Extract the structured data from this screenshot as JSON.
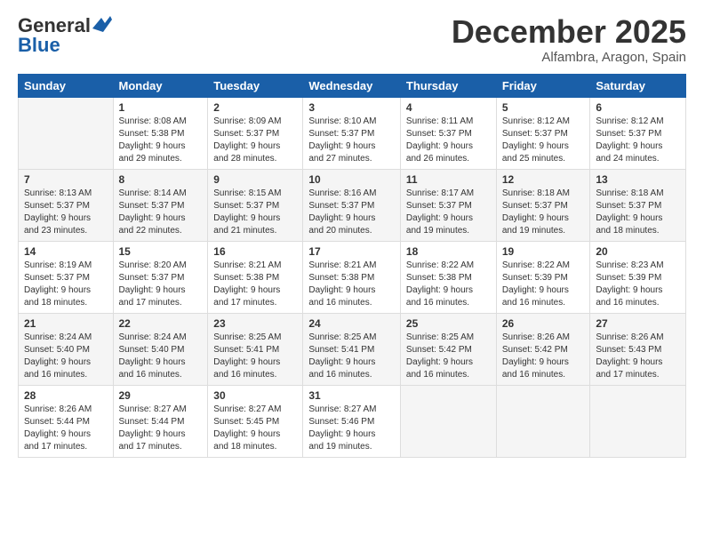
{
  "header": {
    "logo_general": "General",
    "logo_blue": "Blue",
    "month_title": "December 2025",
    "location": "Alfambra, Aragon, Spain"
  },
  "weekdays": [
    "Sunday",
    "Monday",
    "Tuesday",
    "Wednesday",
    "Thursday",
    "Friday",
    "Saturday"
  ],
  "weeks": [
    [
      {
        "day": "",
        "info": ""
      },
      {
        "day": "1",
        "info": "Sunrise: 8:08 AM\nSunset: 5:38 PM\nDaylight: 9 hours\nand 29 minutes."
      },
      {
        "day": "2",
        "info": "Sunrise: 8:09 AM\nSunset: 5:37 PM\nDaylight: 9 hours\nand 28 minutes."
      },
      {
        "day": "3",
        "info": "Sunrise: 8:10 AM\nSunset: 5:37 PM\nDaylight: 9 hours\nand 27 minutes."
      },
      {
        "day": "4",
        "info": "Sunrise: 8:11 AM\nSunset: 5:37 PM\nDaylight: 9 hours\nand 26 minutes."
      },
      {
        "day": "5",
        "info": "Sunrise: 8:12 AM\nSunset: 5:37 PM\nDaylight: 9 hours\nand 25 minutes."
      },
      {
        "day": "6",
        "info": "Sunrise: 8:12 AM\nSunset: 5:37 PM\nDaylight: 9 hours\nand 24 minutes."
      }
    ],
    [
      {
        "day": "7",
        "info": "Sunrise: 8:13 AM\nSunset: 5:37 PM\nDaylight: 9 hours\nand 23 minutes."
      },
      {
        "day": "8",
        "info": "Sunrise: 8:14 AM\nSunset: 5:37 PM\nDaylight: 9 hours\nand 22 minutes."
      },
      {
        "day": "9",
        "info": "Sunrise: 8:15 AM\nSunset: 5:37 PM\nDaylight: 9 hours\nand 21 minutes."
      },
      {
        "day": "10",
        "info": "Sunrise: 8:16 AM\nSunset: 5:37 PM\nDaylight: 9 hours\nand 20 minutes."
      },
      {
        "day": "11",
        "info": "Sunrise: 8:17 AM\nSunset: 5:37 PM\nDaylight: 9 hours\nand 19 minutes."
      },
      {
        "day": "12",
        "info": "Sunrise: 8:18 AM\nSunset: 5:37 PM\nDaylight: 9 hours\nand 19 minutes."
      },
      {
        "day": "13",
        "info": "Sunrise: 8:18 AM\nSunset: 5:37 PM\nDaylight: 9 hours\nand 18 minutes."
      }
    ],
    [
      {
        "day": "14",
        "info": "Sunrise: 8:19 AM\nSunset: 5:37 PM\nDaylight: 9 hours\nand 18 minutes."
      },
      {
        "day": "15",
        "info": "Sunrise: 8:20 AM\nSunset: 5:37 PM\nDaylight: 9 hours\nand 17 minutes."
      },
      {
        "day": "16",
        "info": "Sunrise: 8:21 AM\nSunset: 5:38 PM\nDaylight: 9 hours\nand 17 minutes."
      },
      {
        "day": "17",
        "info": "Sunrise: 8:21 AM\nSunset: 5:38 PM\nDaylight: 9 hours\nand 16 minutes."
      },
      {
        "day": "18",
        "info": "Sunrise: 8:22 AM\nSunset: 5:38 PM\nDaylight: 9 hours\nand 16 minutes."
      },
      {
        "day": "19",
        "info": "Sunrise: 8:22 AM\nSunset: 5:39 PM\nDaylight: 9 hours\nand 16 minutes."
      },
      {
        "day": "20",
        "info": "Sunrise: 8:23 AM\nSunset: 5:39 PM\nDaylight: 9 hours\nand 16 minutes."
      }
    ],
    [
      {
        "day": "21",
        "info": "Sunrise: 8:24 AM\nSunset: 5:40 PM\nDaylight: 9 hours\nand 16 minutes."
      },
      {
        "day": "22",
        "info": "Sunrise: 8:24 AM\nSunset: 5:40 PM\nDaylight: 9 hours\nand 16 minutes."
      },
      {
        "day": "23",
        "info": "Sunrise: 8:25 AM\nSunset: 5:41 PM\nDaylight: 9 hours\nand 16 minutes."
      },
      {
        "day": "24",
        "info": "Sunrise: 8:25 AM\nSunset: 5:41 PM\nDaylight: 9 hours\nand 16 minutes."
      },
      {
        "day": "25",
        "info": "Sunrise: 8:25 AM\nSunset: 5:42 PM\nDaylight: 9 hours\nand 16 minutes."
      },
      {
        "day": "26",
        "info": "Sunrise: 8:26 AM\nSunset: 5:42 PM\nDaylight: 9 hours\nand 16 minutes."
      },
      {
        "day": "27",
        "info": "Sunrise: 8:26 AM\nSunset: 5:43 PM\nDaylight: 9 hours\nand 17 minutes."
      }
    ],
    [
      {
        "day": "28",
        "info": "Sunrise: 8:26 AM\nSunset: 5:44 PM\nDaylight: 9 hours\nand 17 minutes."
      },
      {
        "day": "29",
        "info": "Sunrise: 8:27 AM\nSunset: 5:44 PM\nDaylight: 9 hours\nand 17 minutes."
      },
      {
        "day": "30",
        "info": "Sunrise: 8:27 AM\nSunset: 5:45 PM\nDaylight: 9 hours\nand 18 minutes."
      },
      {
        "day": "31",
        "info": "Sunrise: 8:27 AM\nSunset: 5:46 PM\nDaylight: 9 hours\nand 19 minutes."
      },
      {
        "day": "",
        "info": ""
      },
      {
        "day": "",
        "info": ""
      },
      {
        "day": "",
        "info": ""
      }
    ]
  ]
}
